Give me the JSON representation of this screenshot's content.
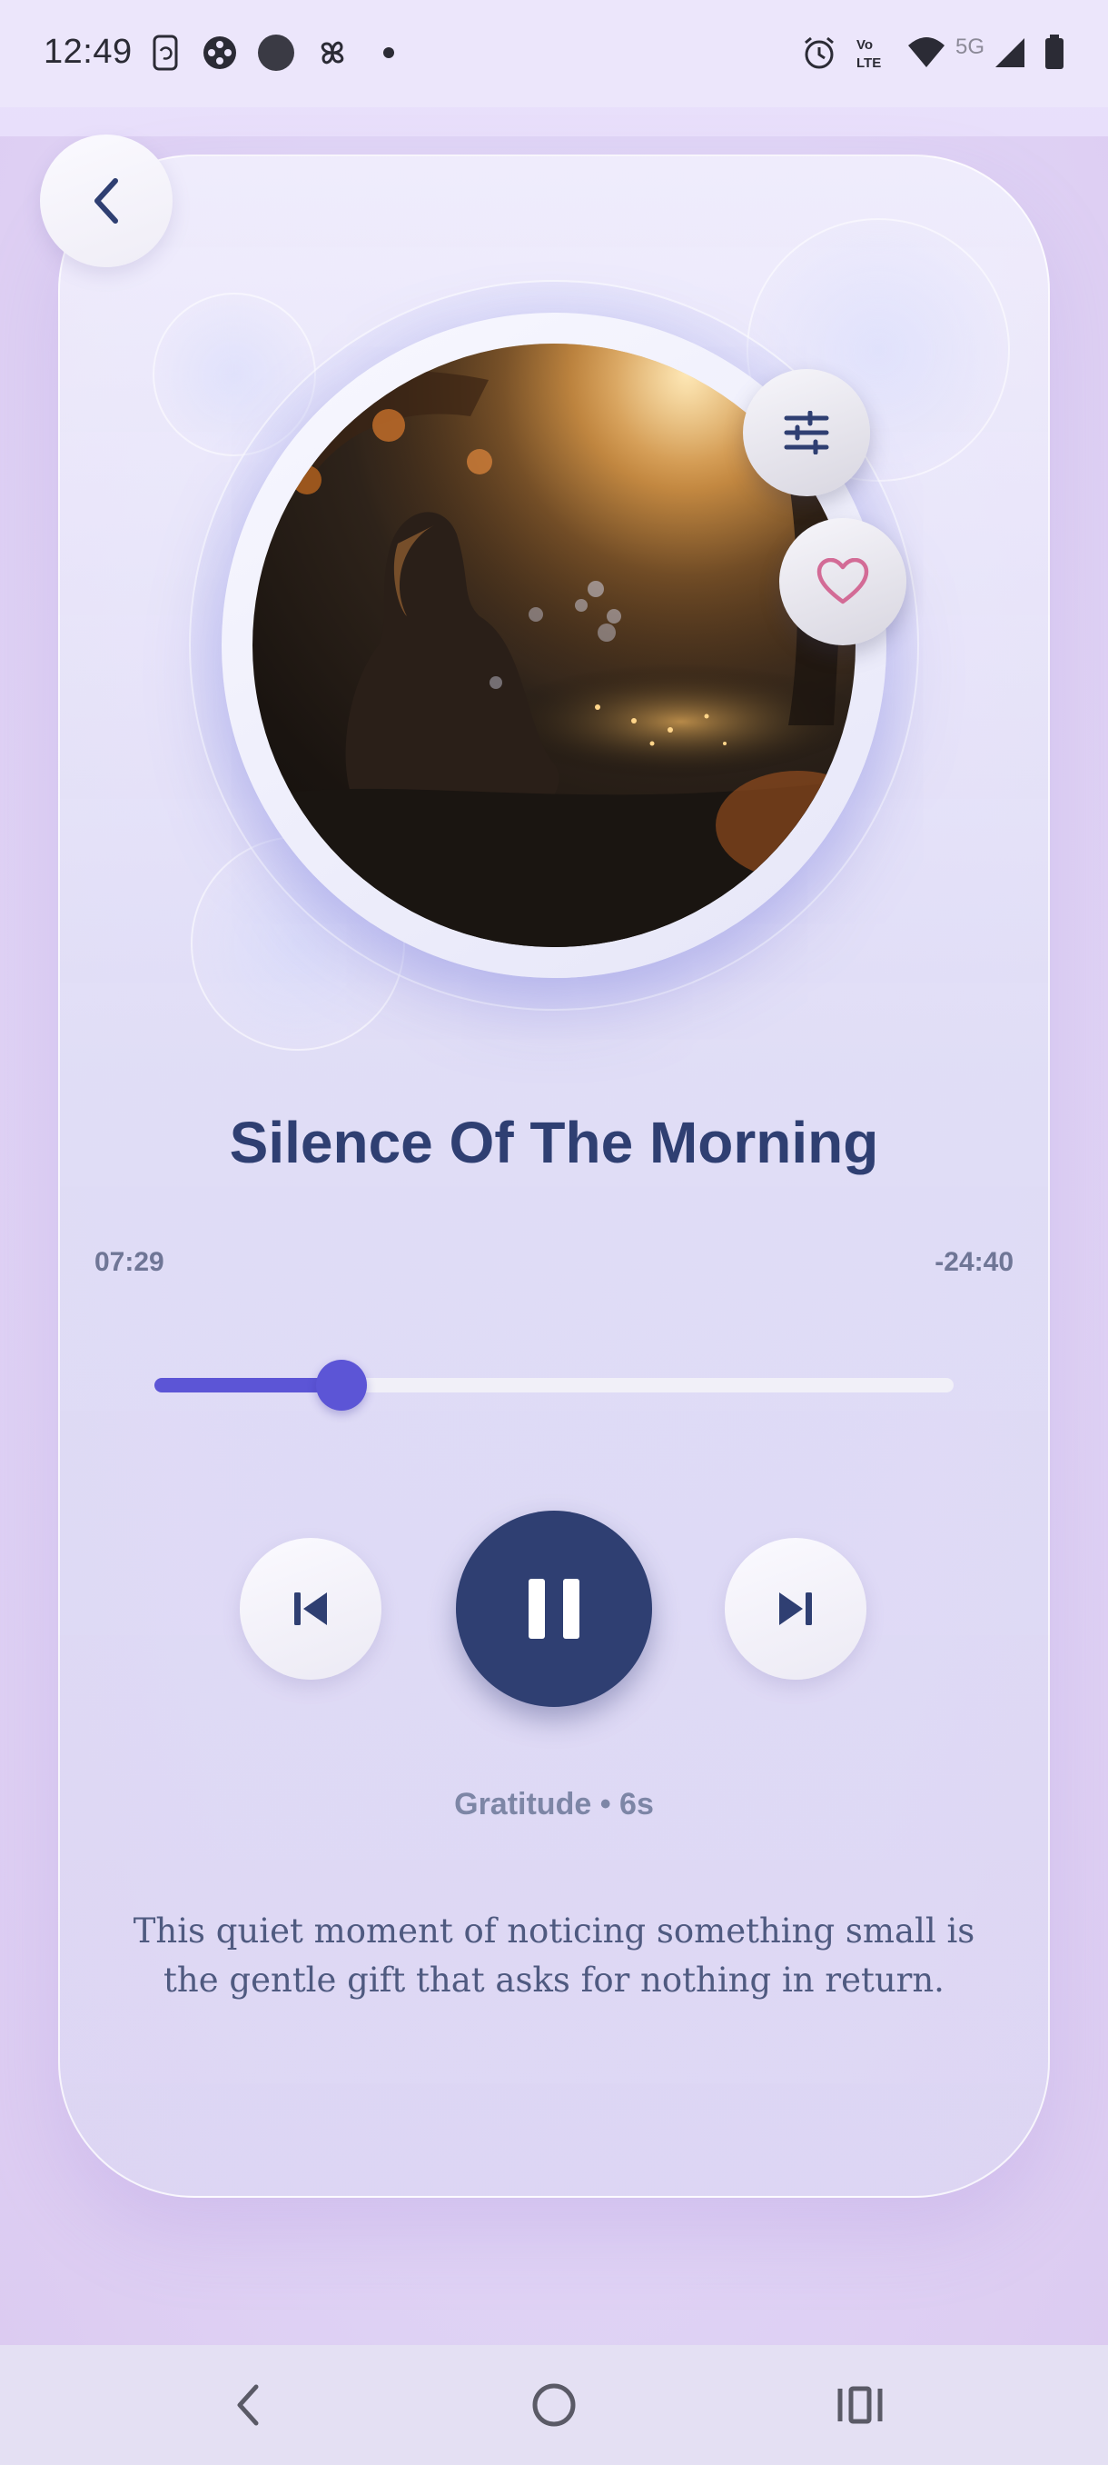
{
  "status_bar": {
    "time": "12:49",
    "network_label": "5G",
    "icons": [
      "phone-sync-icon",
      "game-controller-icon",
      "circle-icon",
      "pinwheel-icon",
      "dot-icon",
      "alarm-icon",
      "volte-icon",
      "wifi-icon",
      "signal-icon",
      "battery-icon"
    ]
  },
  "player": {
    "title": "Silence Of The Morning",
    "elapsed": "07:29",
    "remaining": "-24:40",
    "progress_fraction": 0.234,
    "category_line": "Gratitude • 6s",
    "quote": "This quiet moment of noticing something small is the gentle gift that asks for nothing in return.",
    "favorite": false
  },
  "colors": {
    "accent": "#5c55d6",
    "primary_dark": "#2f3f72",
    "heart": "#d36b96",
    "background": "#e6dcf8"
  },
  "icons": {
    "back": "chevron-left-icon",
    "equalizer": "sliders-icon",
    "favorite": "heart-icon",
    "previous": "skip-previous-icon",
    "play_pause": "pause-icon",
    "next": "skip-next-icon"
  },
  "nav_bar": [
    "nav-back-icon",
    "nav-home-icon",
    "nav-recents-icon"
  ]
}
